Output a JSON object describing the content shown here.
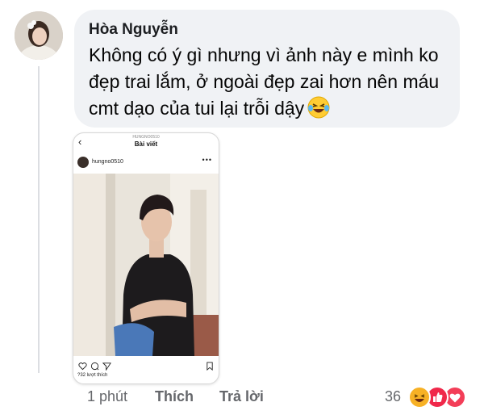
{
  "comment": {
    "author": "Hòa Nguyễn",
    "text": "Không có ý gì nhưng vì ảnh này e mình ko đẹp trai lắm, ở ngoài đẹp zai hơn nên máu cmt dạo của tui lại trỗi dậy",
    "inline_emoji": "laughing-tears-emoji"
  },
  "instagram_post": {
    "top_username": "HUNGNO0510",
    "header_title": "Bài viết",
    "username": "hungno0510",
    "likes_text": "?32 lượt thích"
  },
  "meta": {
    "time": "1 phút",
    "like_label": "Thích",
    "reply_label": "Trả lời",
    "reaction_count": "36",
    "reactions": [
      "haha",
      "like",
      "love"
    ]
  },
  "colors": {
    "bubble": "#f0f2f5",
    "meta_text": "#65676b",
    "like_blue": "#1877f2",
    "love_red": "#f33e58",
    "haha_yellow": "#f7b125"
  }
}
